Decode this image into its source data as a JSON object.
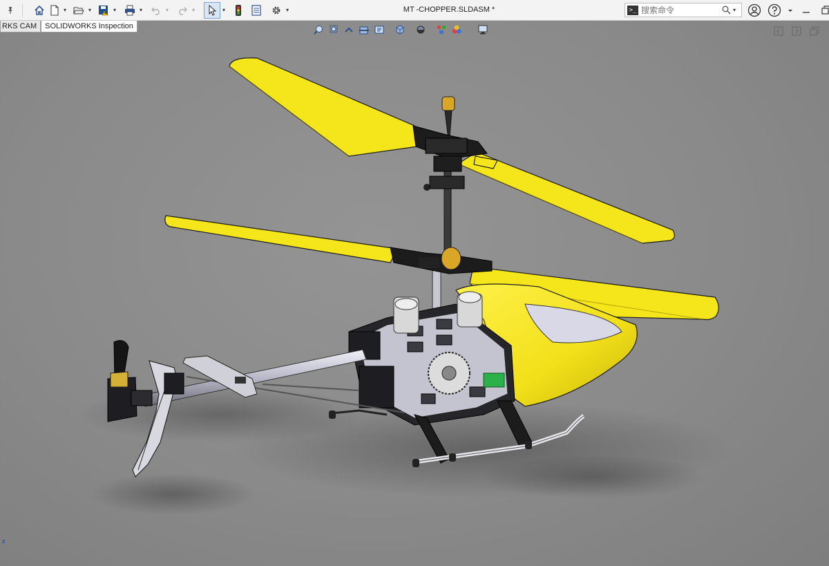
{
  "window": {
    "title": "MT -CHOPPER.SLDASM *"
  },
  "toolbar": {
    "pin_icon": "pin-icon",
    "buttons": [
      "home-icon",
      "new-document-icon",
      "open-icon",
      "save-icon",
      "print-icon",
      "undo-icon",
      "redo-icon",
      "select-icon",
      "traffic-light-icon",
      "file-properties-icon",
      "options-gear-icon"
    ]
  },
  "search": {
    "value": "",
    "placeholder": "搜索命令"
  },
  "tabs": [
    {
      "label": "RKS CAM",
      "active": false
    },
    {
      "label": "SOLIDWORKS Inspection",
      "active": true
    }
  ],
  "viewport": {
    "background": "#8a8a8a",
    "accent_color": "#f5e61c",
    "triad_label": "z"
  },
  "heads_up_toolbar": [
    "zoom-to-fit-icon",
    "zoom-to-area-icon",
    "previous-view-icon",
    "section-view-icon",
    "dynamic-annotation-icon",
    "view-orientation-icon",
    "display-style-icon",
    "hide-show-icon",
    "edit-appearance-icon",
    "apply-scene-icon",
    "view-settings-icon"
  ]
}
